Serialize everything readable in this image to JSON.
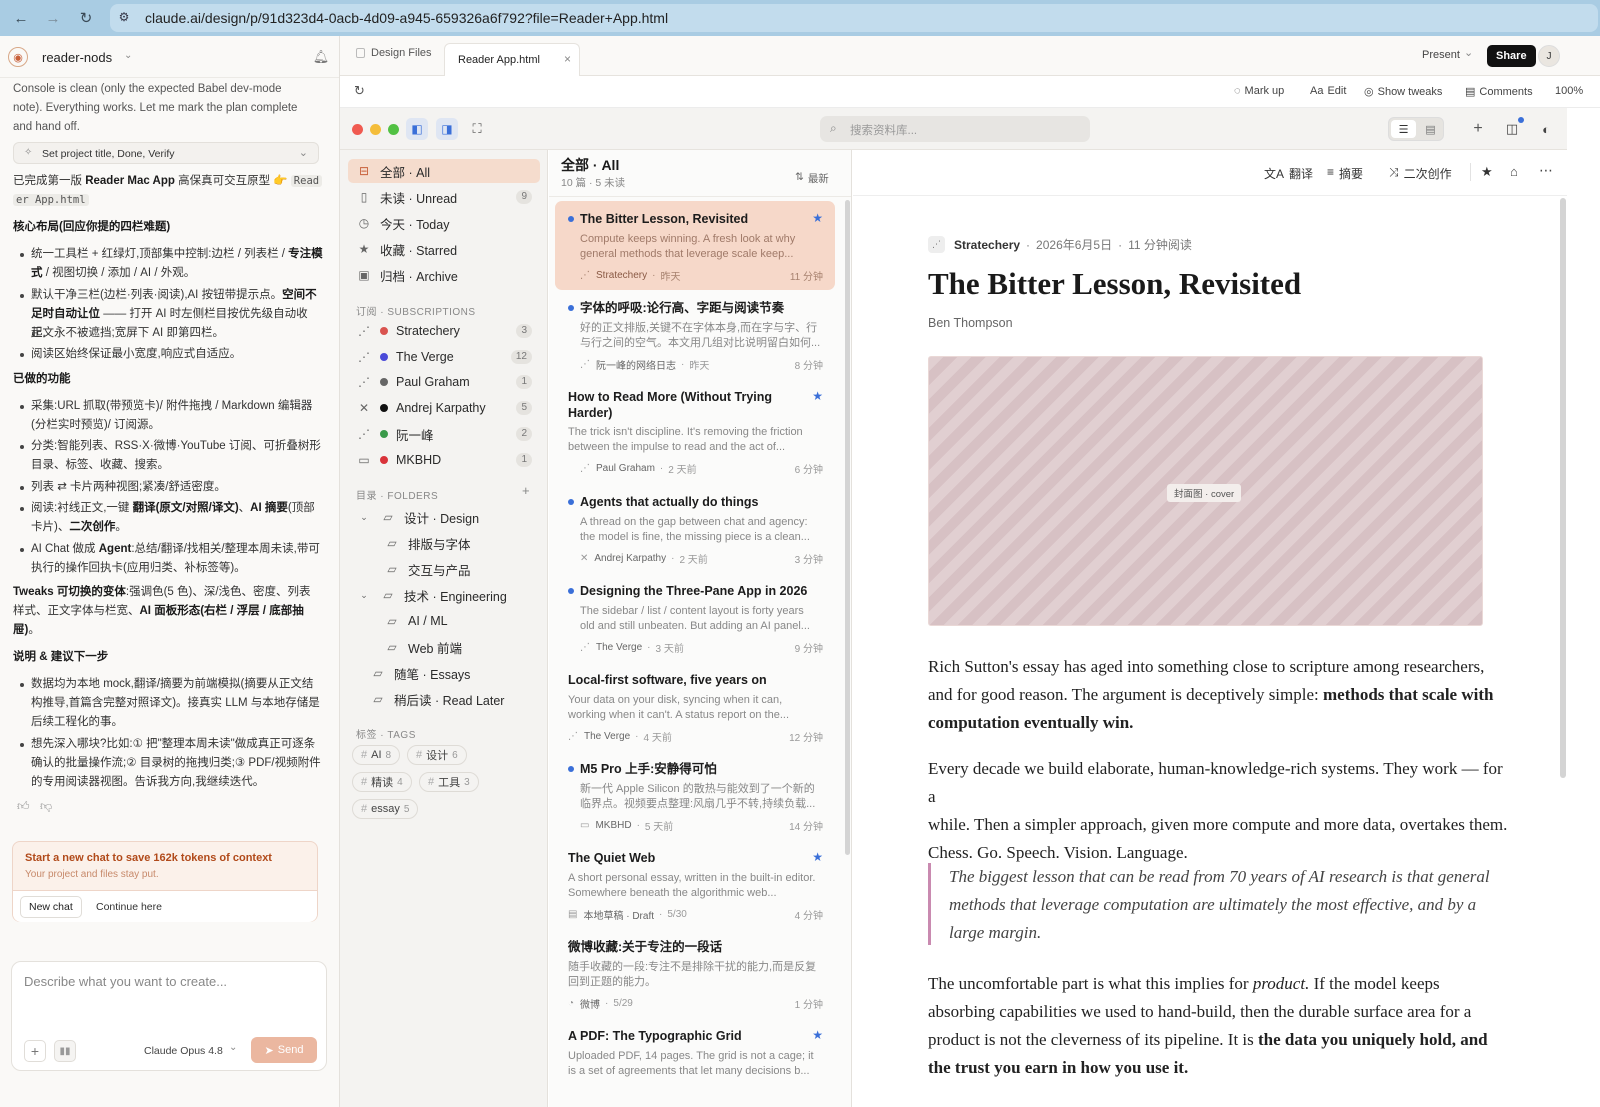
{
  "browser": {
    "url": "claude.ai/design/p/91d323d4-0acb-4d09-a945-659326a6f792?file=Reader+App.html"
  },
  "chat": {
    "project": "reader-nods",
    "intro": [
      "Console is clean (only the expected Babel dev-mode",
      "note). Everything works. Let me mark the plan complete",
      "and hand off."
    ],
    "task_chip": "Set project title, Done, Verify",
    "summary_pre": "已完成第一版 ",
    "summary_bold": "Reader Mac App",
    "summary_post": " 高保真可交互原型 👉 ",
    "summary_code1": "Read",
    "summary_code2": "er App.html",
    "h1": "核心布局(回应你提的四栏难题)",
    "l1a_pre": "统一工具栏 + 红绿灯,顶部集中控制:边栏 / 列表栏 / ",
    "l1a_b": "专注模",
    "l1a_2b": "式",
    "l1a_2": " / 视图切换 / 添加 / AI / 外观。",
    "l2_1": "默认干净三栏(边栏·列表·阅读),AI 按钮带提示点。",
    "l2_1b": "空间不",
    "l2_2b": "足时自动让位",
    "l2_2": " —— 打开 AI 时左侧栏目按优先级自动收起,",
    "l2_3": "正文永不被遮挡;宽屏下 AI 即第四栏。",
    "l3": "阅读区始终保证最小宽度,响应式自适应。",
    "h2": "已做的功能",
    "f1_1": "采集:URL 抓取(带预览卡)/ 附件拖拽 / Markdown 编辑器",
    "f1_2": "(分栏实时预览)/ 订阅源。",
    "f2_1": "分类:智能列表、RSS·X·微博·YouTube 订阅、可折叠树形",
    "f2_2": "目录、标签、收藏、搜索。",
    "f3": "列表 ⇄ 卡片两种视图;紧凑/舒适密度。",
    "f4_1": "阅读:衬线正文,一键 ",
    "f4_1b": "翻译(原文/对照/译文)",
    "f4_1c": "、",
    "f4_1d": "AI 摘要",
    "f4_1e": "(顶部",
    "f4_2": "卡片)、",
    "f4_2b": "二次创作",
    "f4_2c": "。",
    "f5_1": "AI Chat 做成 ",
    "f5_1b": "Agent",
    "f5_1c": ":总结/翻译/找相关/整理本周未读,带可",
    "f5_2": "执行的操作回执卡(应用归类、补标签等)。",
    "t_1b": "Tweaks 可切换的变体",
    "t_1": ":强调色(5 色)、深/浅色、密度、列表",
    "t_2": "样式、正文字体与栏宽、",
    "t_2b": "AI 面板形态(右栏 / 浮层 / 底部抽",
    "t_3b": "屉)",
    "t_3": "。",
    "h3": "说明 & 建议下一步",
    "n1_1": "数据均为本地 mock,翻译/摘要为前端模拟(摘要从正文结",
    "n1_2": "构推导,首篇含完整对照译文)。接真实 LLM 与本地存储是",
    "n1_3": "后续工程化的事。",
    "n2_1": "想先深入哪块?比如:① 把\"整理本周未读\"做成真正可逐条",
    "n2_2": "确认的批量操作流;② 目录树的拖拽归类;③ PDF/视频附件",
    "n2_3": "的专用阅读器视图。告诉我方向,我继续迭代。",
    "banner_title": "Start a new chat to save 162k tokens of context",
    "banner_sub": "Your project and files stay put.",
    "new_chat": "New chat",
    "continue": "Continue here",
    "input_placeholder": "Describe what you want to create...",
    "model": "Claude Opus 4.8",
    "send": "Send"
  },
  "tabs": [
    {
      "label": "Design Files"
    },
    {
      "label": "Reader App.html"
    }
  ],
  "header": {
    "present": "Present",
    "share": "Share",
    "avatar": "J"
  },
  "tools": {
    "markup": "Mark up",
    "edit": "Edit",
    "tweaks": "Show tweaks",
    "comments": "Comments",
    "zoom": "100%"
  },
  "app": {
    "search_placeholder": "搜索资料库...",
    "nav": [
      {
        "label": "全部 · All",
        "count": ""
      },
      {
        "label": "未读 · Unread",
        "count": "9"
      },
      {
        "label": "今天 · Today",
        "count": ""
      },
      {
        "label": "收藏 · Starred",
        "count": ""
      },
      {
        "label": "归档 · Archive",
        "count": ""
      }
    ],
    "subs_title": "订阅 · SUBSCRIPTIONS",
    "subs": [
      {
        "label": "Stratechery",
        "count": "3",
        "color": "#d9534f"
      },
      {
        "label": "The Verge",
        "count": "12",
        "color": "#4a4ad8"
      },
      {
        "label": "Paul Graham",
        "count": "1",
        "color": "#666666"
      },
      {
        "label": "Andrej Karpathy",
        "count": "5",
        "color": "#111111"
      },
      {
        "label": "阮一峰",
        "count": "2",
        "color": "#3a9a4a"
      },
      {
        "label": "MKBHD",
        "count": "1",
        "color": "#d9333a"
      }
    ],
    "folders_title": "目录 · FOLDERS",
    "folders": [
      {
        "label": "设计 · Design"
      },
      {
        "label": "排版与字体"
      },
      {
        "label": "交互与产品"
      },
      {
        "label": "技术 · Engineering"
      },
      {
        "label": "AI / ML"
      },
      {
        "label": "Web 前端"
      },
      {
        "label": "随笔 · Essays"
      },
      {
        "label": "稍后读 · Read Later"
      }
    ],
    "tags_title": "标签 · TAGS",
    "tags": [
      {
        "label": "AI",
        "count": "8"
      },
      {
        "label": "设计",
        "count": "6"
      },
      {
        "label": "精读",
        "count": "4"
      },
      {
        "label": "工具",
        "count": "3"
      },
      {
        "label": "essay",
        "count": "5"
      }
    ],
    "list": {
      "title": "全部 · All",
      "sub": "10 篇 · 5 未读",
      "sort": "最新",
      "items": [
        {
          "title": "The Bitter Lesson, Revisited",
          "excerpt": "Compute keeps winning. A fresh look at why general methods that leverage scale keep...",
          "source": "Stratechery",
          "time": "昨天",
          "read": "11 分钟"
        },
        {
          "title": "字体的呼吸:论行高、字距与阅读节奏",
          "excerpt": "好的正文排版,关键不在字体本身,而在字与字、行与行之间的空气。本文用几组对比说明留白如何...",
          "source": "阮一峰的网络日志",
          "time": "昨天",
          "read": "8 分钟"
        },
        {
          "title": "How to Read More (Without Trying Harder)",
          "excerpt": "The trick isn't discipline. It's removing the friction between the impulse to read and the act of...",
          "source": "Paul Graham",
          "time": "2 天前",
          "read": "6 分钟"
        },
        {
          "title": "Agents that actually do things",
          "excerpt": "A thread on the gap between chat and agency: the model is fine, the missing piece is a clean...",
          "source": "Andrej Karpathy",
          "time": "2 天前",
          "read": "3 分钟"
        },
        {
          "title": "Designing the Three-Pane App in 2026",
          "excerpt": "The sidebar / list / content layout is forty years old and still unbeaten. But adding an AI panel...",
          "source": "The Verge",
          "time": "3 天前",
          "read": "9 分钟"
        },
        {
          "title": "Local-first software, five years on",
          "excerpt": "Your data on your disk, syncing when it can, working when it can't. A status report on the...",
          "source": "The Verge",
          "time": "4 天前",
          "read": "12 分钟"
        },
        {
          "title": "M5 Pro 上手:安静得可怕",
          "excerpt": "新一代 Apple Silicon 的散热与能效到了一个新的临界点。视频要点整理:风扇几乎不转,持续负载...",
          "source": "MKBHD",
          "time": "5 天前",
          "read": "14 分钟"
        },
        {
          "title": "The Quiet Web",
          "excerpt": "A short personal essay, written in the built-in editor. Somewhere beneath the algorithmic web...",
          "source": "本地草稿 · Draft",
          "time": "5/30",
          "read": "4 分钟"
        },
        {
          "title": "微博收藏:关于专注的一段话",
          "excerpt": "随手收藏的一段:专注不是排除干扰的能力,而是反复回到正题的能力。",
          "source": "微博",
          "time": "5/29",
          "read": "1 分钟"
        },
        {
          "title": "A PDF: The Typographic Grid",
          "excerpt": "Uploaded PDF, 14 pages. The grid is not a cage; it is a set of agreements that let many decisions b...",
          "source": "",
          "time": "",
          "read": ""
        }
      ]
    },
    "reader": {
      "actions": {
        "translate": "翻译",
        "summary": "摘要",
        "remix": "二次创作"
      },
      "source": "Stratechery",
      "date": "2026年6月5日",
      "read": "11 分钟阅读",
      "title": "The Bitter Lesson, Revisited",
      "author": "Ben Thompson",
      "cover": "封面图 · cover",
      "p1a": "Rich Sutton's essay has aged into something close to scripture among researchers,",
      "p1b": "and for good reason. The argument is deceptively simple: ",
      "p1b_bold": "methods that scale with",
      "p1c_bold": "computation eventually win.",
      "p2a": "Every decade we build elaborate, human-knowledge-rich systems. They work — for a",
      "p2b": "while. Then a simpler approach, given more compute and more data, overtakes them.",
      "p2c": "Chess. Go. Speech. Vision. Language.",
      "q1": "The biggest lesson that can be read from 70 years of AI research is that general",
      "q2": "methods that leverage computation are ultimately the most effective, and by a",
      "q3": "large margin.",
      "p3a_pre": "The uncomfortable part is what this implies for ",
      "p3a_em": "product.",
      "p3a_post": " If the model keeps",
      "p3b": "absorbing capabilities we used to hand-build, then the durable surface area for a",
      "p3c_pre": "product is not the cleverness of its pipeline. It is ",
      "p3c_bold": "the data you uniquely hold, and",
      "p3d_bold": "the trust you earn in how you use it."
    }
  }
}
